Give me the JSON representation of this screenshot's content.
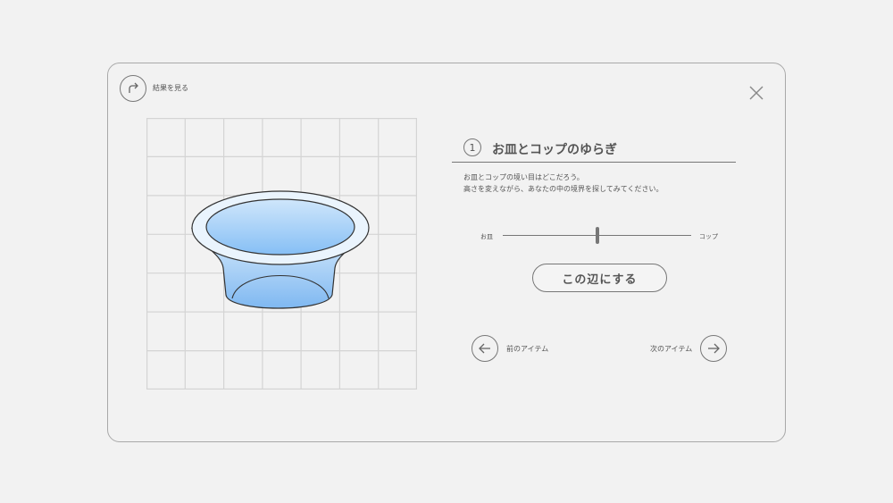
{
  "header": {
    "results_label": "結果を見る",
    "results_icon": "redo-arrow-icon",
    "close_icon": "close-icon"
  },
  "question": {
    "number": "1",
    "title": "お皿とコップのゆらぎ",
    "description_line1": "お皿とコップの境い目はどこだろう。",
    "description_line2": "高さを変えながら、あなたの中の境界を探してみてください。"
  },
  "slider": {
    "left_label": "お皿",
    "right_label": "コップ",
    "value_fraction": 0.5
  },
  "confirm_button": "この辺にする",
  "navigation": {
    "prev_label": "前のアイテム",
    "next_label": "次のアイテム",
    "prev_icon": "arrow-left-icon",
    "next_icon": "arrow-right-icon"
  },
  "colors": {
    "background": "#f2f2f2",
    "border": "#a9a9a9",
    "text": "#555555",
    "bowl_blue": "#8ec2f4"
  }
}
